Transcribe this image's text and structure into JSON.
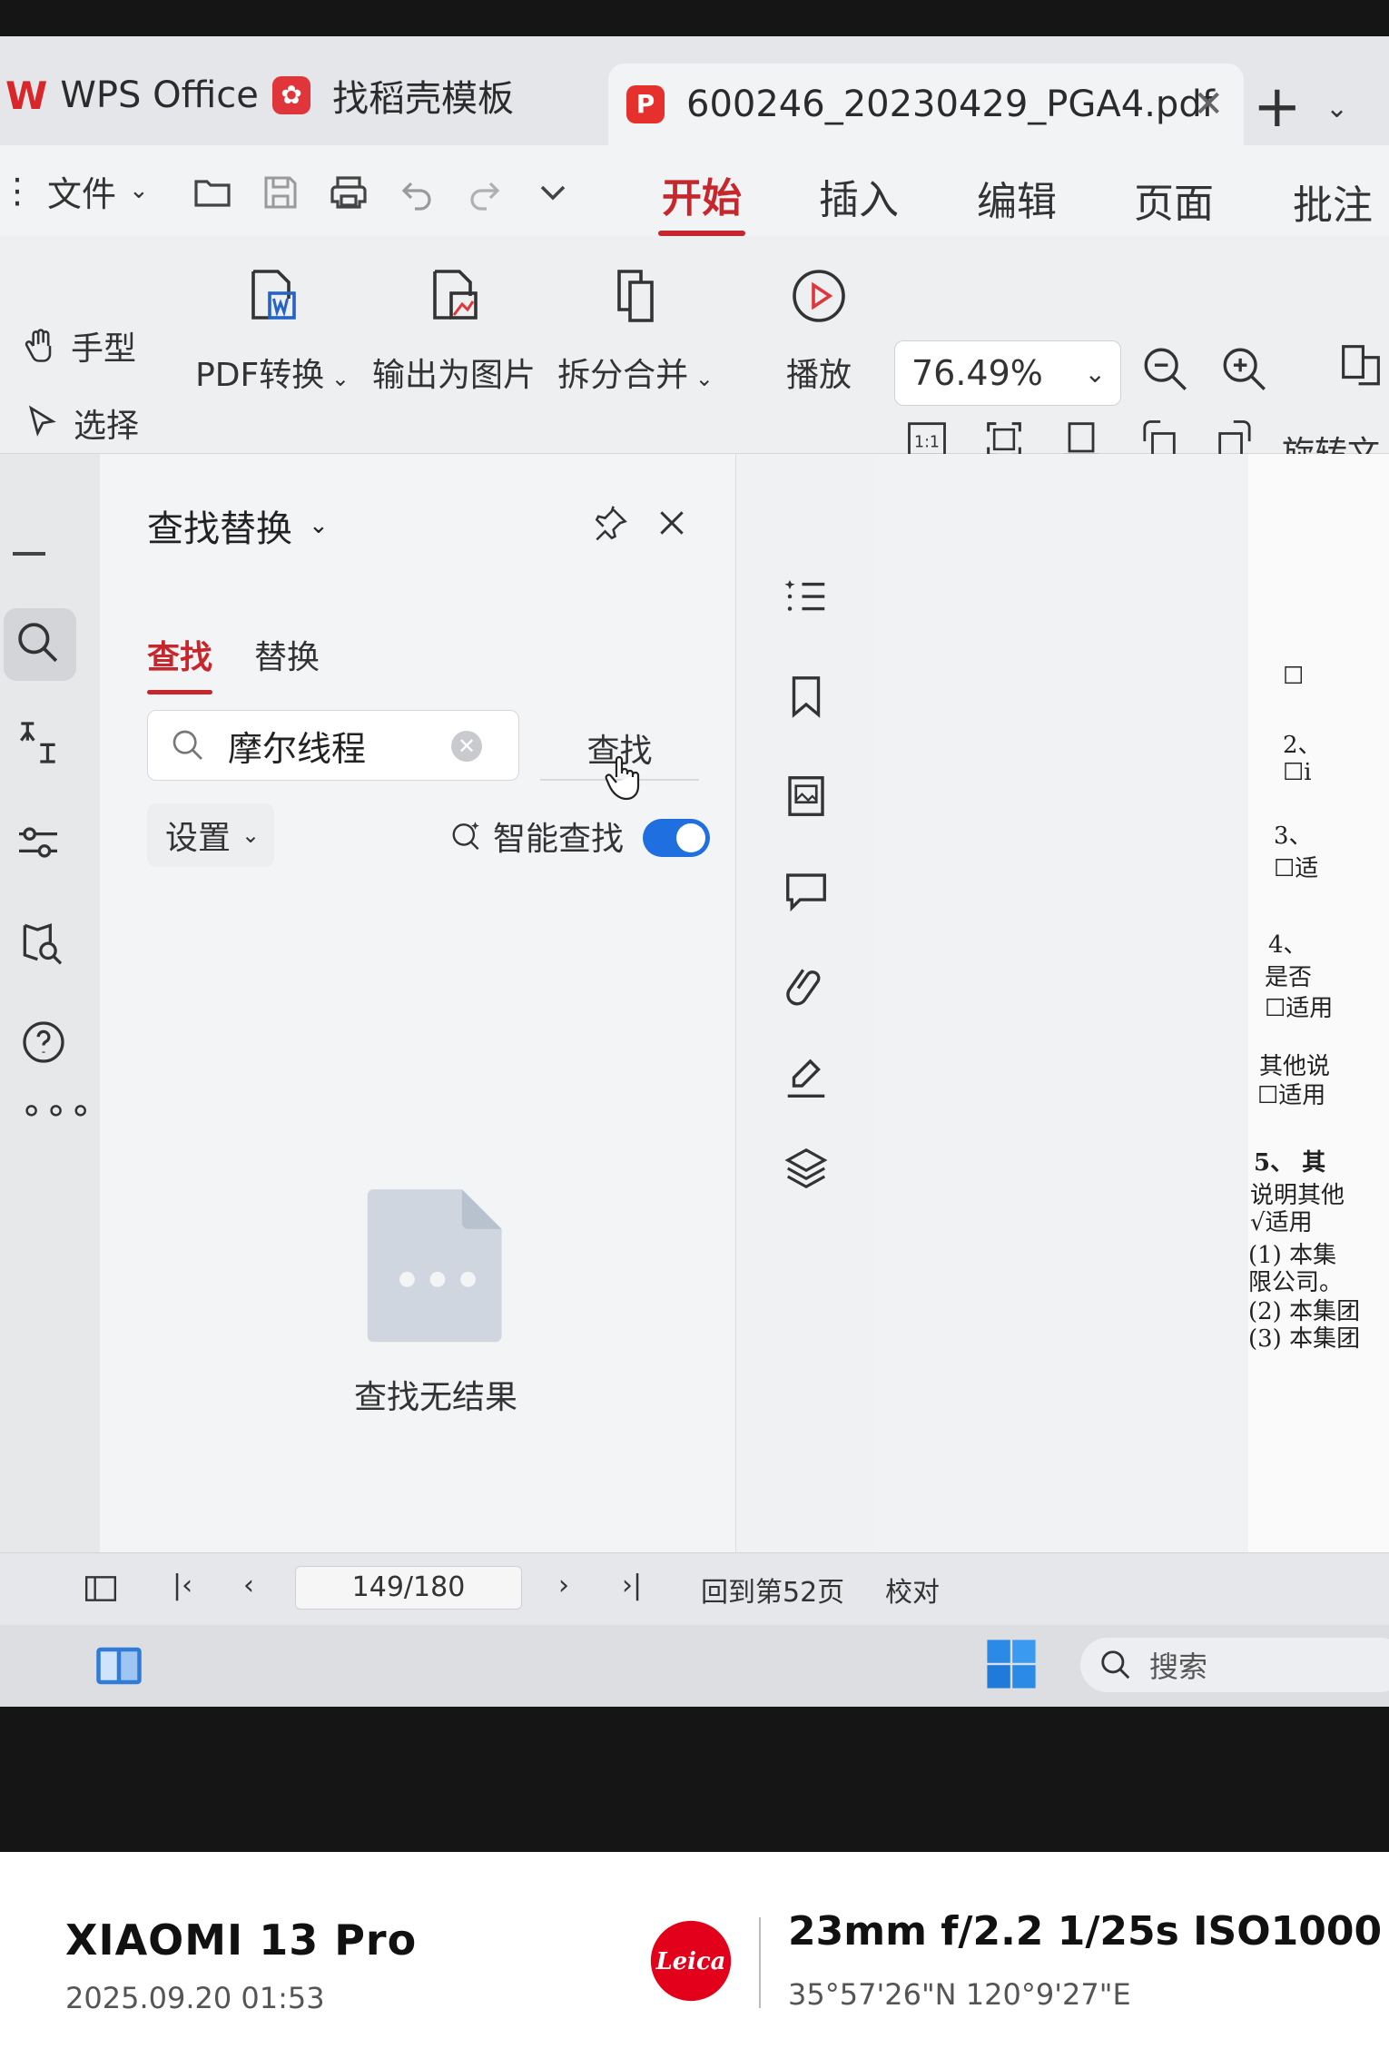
{
  "tabs": [
    {
      "label": "WPS Office"
    },
    {
      "label": "找稻壳模板"
    },
    {
      "label": "600246_20230429_PGA4.pdf"
    }
  ],
  "menu": {
    "file_label": "文件",
    "tabs": [
      "开始",
      "插入",
      "编辑",
      "页面",
      "批注"
    ],
    "active_tab": "开始"
  },
  "ribbon": {
    "hand_label": "手型",
    "select_label": "选择",
    "pdf_convert_label": "PDF转换",
    "export_image_label": "输出为图片",
    "split_merge_label": "拆分合并",
    "play_label": "播放",
    "zoom_value": "76.49%",
    "rotate_label": "旋转文档"
  },
  "find_panel": {
    "title": "查找替换",
    "tab_find": "查找",
    "tab_replace": "替换",
    "search_value": "摩尔线程",
    "find_button": "查找",
    "settings_label": "设置",
    "smart_find_label": "智能查找",
    "smart_find_enabled": true,
    "empty_text": "查找无结果"
  },
  "document": {
    "lines": [
      "2、",
      "☐i",
      "3、",
      "☐适",
      "4、",
      "是否",
      "☐适用",
      "其他说",
      "☐适用",
      "5、 其",
      "说明其他",
      "√适用",
      "(1) 本集",
      "限公司。",
      "(2) 本集团",
      "(3) 本集团"
    ]
  },
  "statusbar": {
    "page_indicator": "149/180",
    "back_to_page": "回到第52页",
    "proofread": "校对"
  },
  "taskbar": {
    "search_label": "搜索"
  },
  "watermark": {
    "brand": "XIAOMI 13 Pro",
    "datetime": "2025.09.20 01:53",
    "specs": "23mm  f/2.2  1/25s  ISO1000",
    "gps": "35°57'26\"N  120°9'27\"E",
    "leica_text": "Leica"
  },
  "colors": {
    "accent": "#c7262c",
    "toggle_on": "#1f6fe0"
  }
}
